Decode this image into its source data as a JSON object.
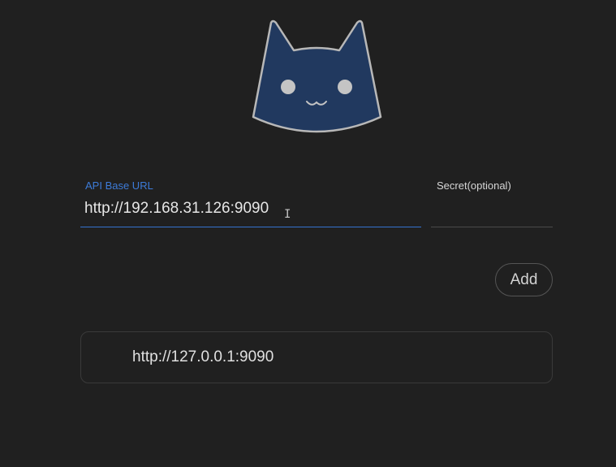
{
  "logo": {
    "icon": "cat-head-icon",
    "fill_color": "#21395f",
    "stroke_color": "#b8b8b8"
  },
  "form": {
    "api_base_url": {
      "label": "API Base URL",
      "value": "http://192.168.31.126:9090",
      "accent_color": "#3d7bd8"
    },
    "secret": {
      "label": "Secret(optional)",
      "value": ""
    },
    "add_label": "Add"
  },
  "servers": [
    {
      "url": "http://127.0.0.1:9090"
    }
  ]
}
